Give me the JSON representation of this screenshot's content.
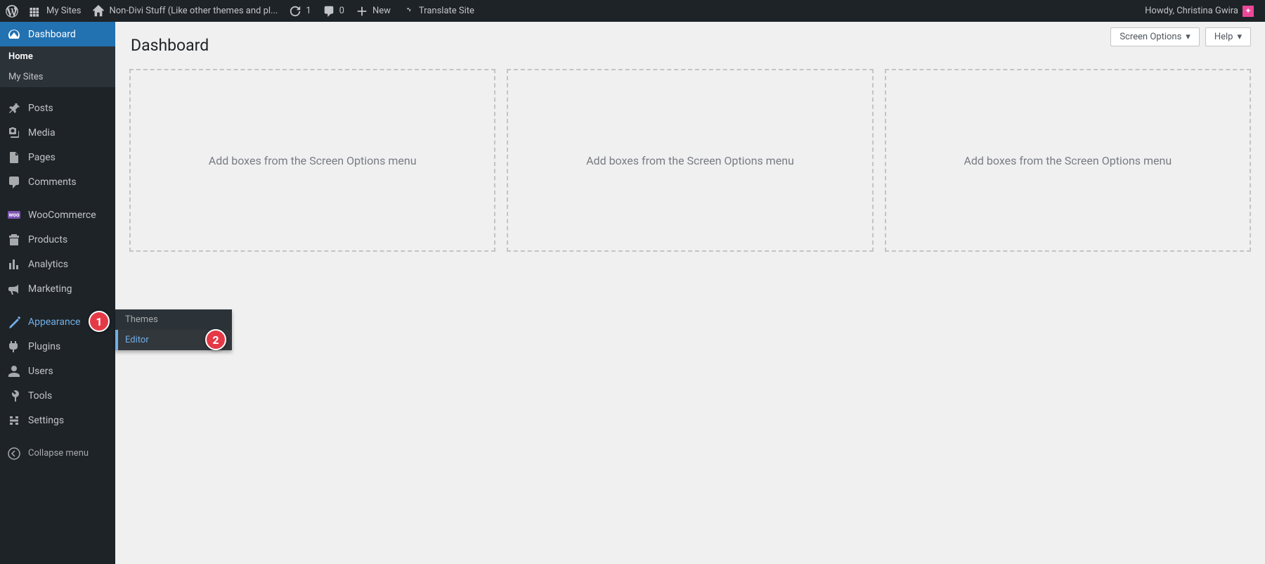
{
  "adminbar": {
    "my_sites": "My Sites",
    "site_name": "Non-Divi Stuff (Like other themes and pl...",
    "refresh_count": "1",
    "comments_count": "0",
    "new_label": "New",
    "translate_label": "Translate Site",
    "howdy": "Howdy, Christina Gwira"
  },
  "sidebar": {
    "dashboard": "Dashboard",
    "home": "Home",
    "mysites": "My Sites",
    "posts": "Posts",
    "media": "Media",
    "pages": "Pages",
    "comments": "Comments",
    "woocommerce": "WooCommerce",
    "products": "Products",
    "analytics": "Analytics",
    "marketing": "Marketing",
    "appearance": "Appearance",
    "plugins": "Plugins",
    "users": "Users",
    "tools": "Tools",
    "settings": "Settings",
    "collapse": "Collapse menu"
  },
  "flyout": {
    "themes": "Themes",
    "editor": "Editor"
  },
  "annotations": {
    "one": "1",
    "two": "2"
  },
  "content": {
    "title": "Dashboard",
    "screen_options": "Screen Options",
    "help": "Help",
    "box_prompt": "Add boxes from the Screen Options menu"
  }
}
